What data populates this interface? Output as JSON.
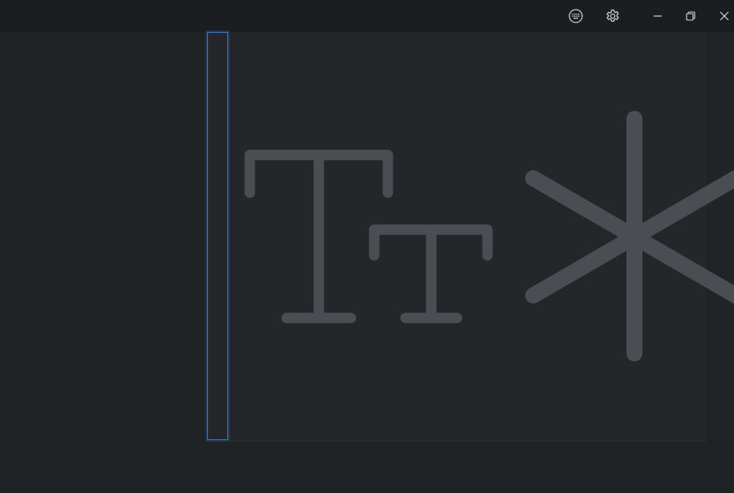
{
  "titlebar": {
    "icons": [
      "keyboard-icon",
      "settings-icon",
      "minimize-icon",
      "restore-icon",
      "close-icon"
    ]
  },
  "canvas": {
    "art_icons": [
      "font-size-icon",
      "asterisk-icon"
    ],
    "caret_color": "#3f72b4",
    "art_color": "#4a4e52"
  }
}
